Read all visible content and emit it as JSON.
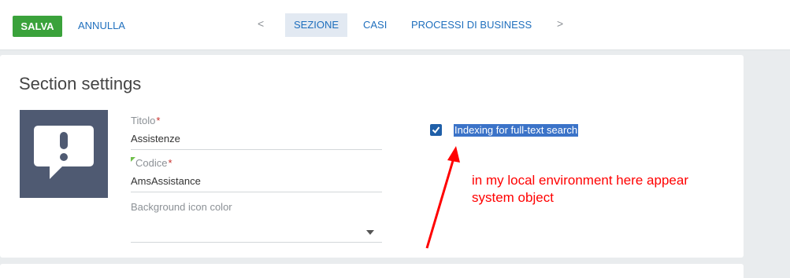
{
  "toolbar": {
    "save_label": "SALVA",
    "cancel_label": "ANNULLA",
    "tabs": [
      {
        "label": "SEZIONE",
        "active": true
      },
      {
        "label": "CASI",
        "active": false
      },
      {
        "label": "PROCESSI DI BUSINESS",
        "active": false
      }
    ],
    "prev_arrow": "<",
    "next_arrow": ">"
  },
  "section": {
    "title": "Section settings",
    "icon": "chat-exclamation-icon",
    "icon_bg_color": "#4f5a72"
  },
  "fields": {
    "title": {
      "label": "Titolo",
      "required_mark": "*",
      "value": "Assistenze"
    },
    "code": {
      "label": "Codice",
      "required_mark": "*",
      "value": "AmsAssistance"
    },
    "bg_color": {
      "label": "Background icon color",
      "value": ""
    }
  },
  "indexing": {
    "label": "Indexing for full-text search",
    "checked": true
  },
  "annotation": {
    "line1": "in my local environment here appear",
    "line2": "system object",
    "color": "#ff0000"
  },
  "colors": {
    "save_button": "#3aa23b",
    "link": "#1f6fbd",
    "active_tab_bg": "#e2e9f2"
  }
}
